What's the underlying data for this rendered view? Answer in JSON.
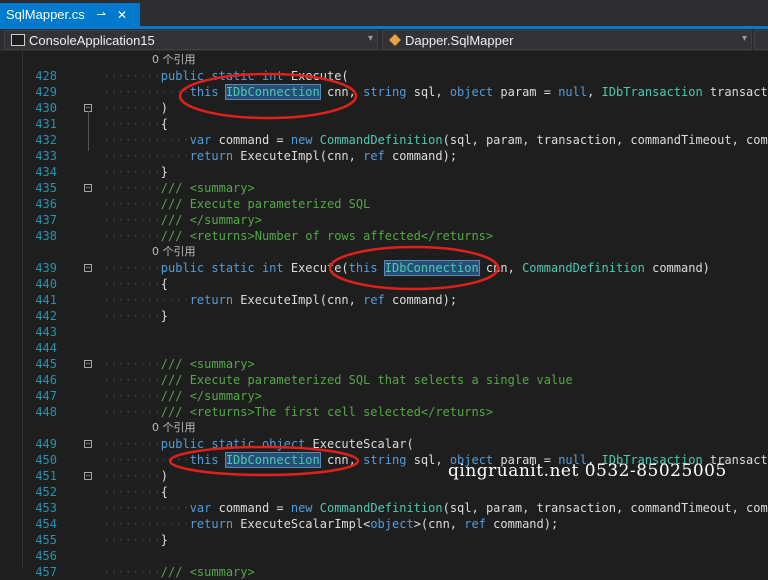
{
  "tab": {
    "title": "SqlMapper.cs",
    "pin_glyph": "⇀",
    "close_glyph": "✕"
  },
  "navbar": {
    "project": "ConsoleApplication15",
    "scope": "Dapper.SqlMapper",
    "dropdown_arrow": "▾"
  },
  "editor": {
    "lines": [
      {
        "num": "",
        "ref": "0 个引用"
      },
      {
        "num": "428",
        "indent": 2,
        "tokens": [
          [
            "public ",
            "kw"
          ],
          [
            "static ",
            "kw"
          ],
          [
            "int ",
            "kw"
          ],
          [
            "Execute(",
            ""
          ]
        ]
      },
      {
        "num": "429",
        "indent": 3,
        "tokens": [
          [
            "this ",
            "kw"
          ],
          [
            "IDbConnection",
            "hl"
          ],
          [
            " cnn, ",
            ""
          ],
          [
            "string ",
            "kw"
          ],
          [
            "sql, ",
            ""
          ],
          [
            "object ",
            "kw"
          ],
          [
            "param = ",
            ""
          ],
          [
            "null",
            "kw"
          ],
          [
            ", ",
            ""
          ],
          [
            "IDbTransaction ",
            "ty"
          ],
          [
            "transaction",
            ""
          ]
        ]
      },
      {
        "num": "430",
        "indent": 2,
        "fold": true,
        "tokens": [
          [
            ")",
            ""
          ]
        ]
      },
      {
        "num": "431",
        "indent": 2,
        "tokens": [
          [
            "{",
            ""
          ]
        ]
      },
      {
        "num": "432",
        "indent": 3,
        "tokens": [
          [
            "var ",
            "kw"
          ],
          [
            "command = ",
            ""
          ],
          [
            "new ",
            "kw"
          ],
          [
            "CommandDefinition",
            "ty"
          ],
          [
            "(sql, param, transaction, commandTimeout, command",
            ""
          ]
        ]
      },
      {
        "num": "433",
        "indent": 3,
        "tokens": [
          [
            "return ",
            "kw"
          ],
          [
            "ExecuteImpl(cnn, ",
            ""
          ],
          [
            "ref ",
            "kw"
          ],
          [
            "command);",
            ""
          ]
        ]
      },
      {
        "num": "434",
        "indent": 2,
        "tokens": [
          [
            "}",
            ""
          ]
        ]
      },
      {
        "num": "435",
        "indent": 2,
        "fold": true,
        "tokens": [
          [
            "/// <summary>",
            "cm"
          ]
        ]
      },
      {
        "num": "436",
        "indent": 2,
        "tokens": [
          [
            "/// Execute parameterized SQL",
            "cm"
          ]
        ]
      },
      {
        "num": "437",
        "indent": 2,
        "tokens": [
          [
            "/// </summary>",
            "cm"
          ]
        ]
      },
      {
        "num": "438",
        "indent": 2,
        "tokens": [
          [
            "/// <returns>Number of rows affected</returns>",
            "cm"
          ]
        ]
      },
      {
        "num": "",
        "ref": "0 个引用"
      },
      {
        "num": "439",
        "indent": 2,
        "fold": true,
        "tokens": [
          [
            "public ",
            "kw"
          ],
          [
            "static ",
            "kw"
          ],
          [
            "int ",
            "kw"
          ],
          [
            "Execute(",
            ""
          ],
          [
            "this ",
            "kw"
          ],
          [
            "IDbConnection",
            "hl"
          ],
          [
            " cnn, ",
            ""
          ],
          [
            "CommandDefinition ",
            "ty"
          ],
          [
            "command)",
            ""
          ]
        ]
      },
      {
        "num": "440",
        "indent": 2,
        "tokens": [
          [
            "{",
            ""
          ]
        ]
      },
      {
        "num": "441",
        "indent": 3,
        "tokens": [
          [
            "return ",
            "kw"
          ],
          [
            "ExecuteImpl(cnn, ",
            ""
          ],
          [
            "ref ",
            "kw"
          ],
          [
            "command);",
            ""
          ]
        ]
      },
      {
        "num": "442",
        "indent": 2,
        "tokens": [
          [
            "}",
            ""
          ]
        ]
      },
      {
        "num": "443",
        "indent": 0,
        "tokens": []
      },
      {
        "num": "444",
        "indent": 0,
        "tokens": []
      },
      {
        "num": "445",
        "indent": 2,
        "fold": true,
        "tokens": [
          [
            "/// <summary>",
            "cm"
          ]
        ]
      },
      {
        "num": "446",
        "indent": 2,
        "tokens": [
          [
            "/// Execute parameterized SQL that selects a single value",
            "cm"
          ]
        ]
      },
      {
        "num": "447",
        "indent": 2,
        "tokens": [
          [
            "/// </summary>",
            "cm"
          ]
        ]
      },
      {
        "num": "448",
        "indent": 2,
        "tokens": [
          [
            "/// <returns>The first cell selected</returns>",
            "cm"
          ]
        ]
      },
      {
        "num": "",
        "ref": "0 个引用"
      },
      {
        "num": "449",
        "indent": 2,
        "fold": true,
        "tokens": [
          [
            "public ",
            "kw"
          ],
          [
            "static ",
            "kw"
          ],
          [
            "object ",
            "kw"
          ],
          [
            "ExecuteScalar(",
            ""
          ]
        ]
      },
      {
        "num": "450",
        "indent": 3,
        "tokens": [
          [
            "this ",
            "kw"
          ],
          [
            "IDbConnection",
            "hl"
          ],
          [
            " cnn, ",
            ""
          ],
          [
            "string ",
            "kw"
          ],
          [
            "sql, ",
            ""
          ],
          [
            "object ",
            "kw"
          ],
          [
            "param = ",
            ""
          ],
          [
            "null",
            "kw"
          ],
          [
            ", ",
            ""
          ],
          [
            "IDbTransaction ",
            "ty"
          ],
          [
            "transaction",
            ""
          ]
        ]
      },
      {
        "num": "451",
        "indent": 2,
        "fold": true,
        "tokens": [
          [
            ")",
            ""
          ]
        ]
      },
      {
        "num": "452",
        "indent": 2,
        "tokens": [
          [
            "{",
            ""
          ]
        ]
      },
      {
        "num": "453",
        "indent": 3,
        "tokens": [
          [
            "var ",
            "kw"
          ],
          [
            "command = ",
            ""
          ],
          [
            "new ",
            "kw"
          ],
          [
            "CommandDefinition",
            "ty"
          ],
          [
            "(sql, param, transaction, commandTimeout, command",
            ""
          ]
        ]
      },
      {
        "num": "454",
        "indent": 3,
        "tokens": [
          [
            "return ",
            "kw"
          ],
          [
            "ExecuteScalarImpl<",
            ""
          ],
          [
            "object",
            "kw"
          ],
          [
            ">(cnn, ",
            ""
          ],
          [
            "ref ",
            "kw"
          ],
          [
            "command);",
            ""
          ]
        ]
      },
      {
        "num": "455",
        "indent": 2,
        "tokens": [
          [
            "}",
            ""
          ]
        ]
      },
      {
        "num": "456",
        "indent": 0,
        "tokens": []
      },
      {
        "num": "457",
        "indent": 2,
        "tokens": [
          [
            "/// <summary>",
            "cm"
          ]
        ]
      }
    ]
  },
  "watermark": {
    "text": "qingruanit.net 0532-85025005"
  },
  "annotation_color": "#e0201b"
}
